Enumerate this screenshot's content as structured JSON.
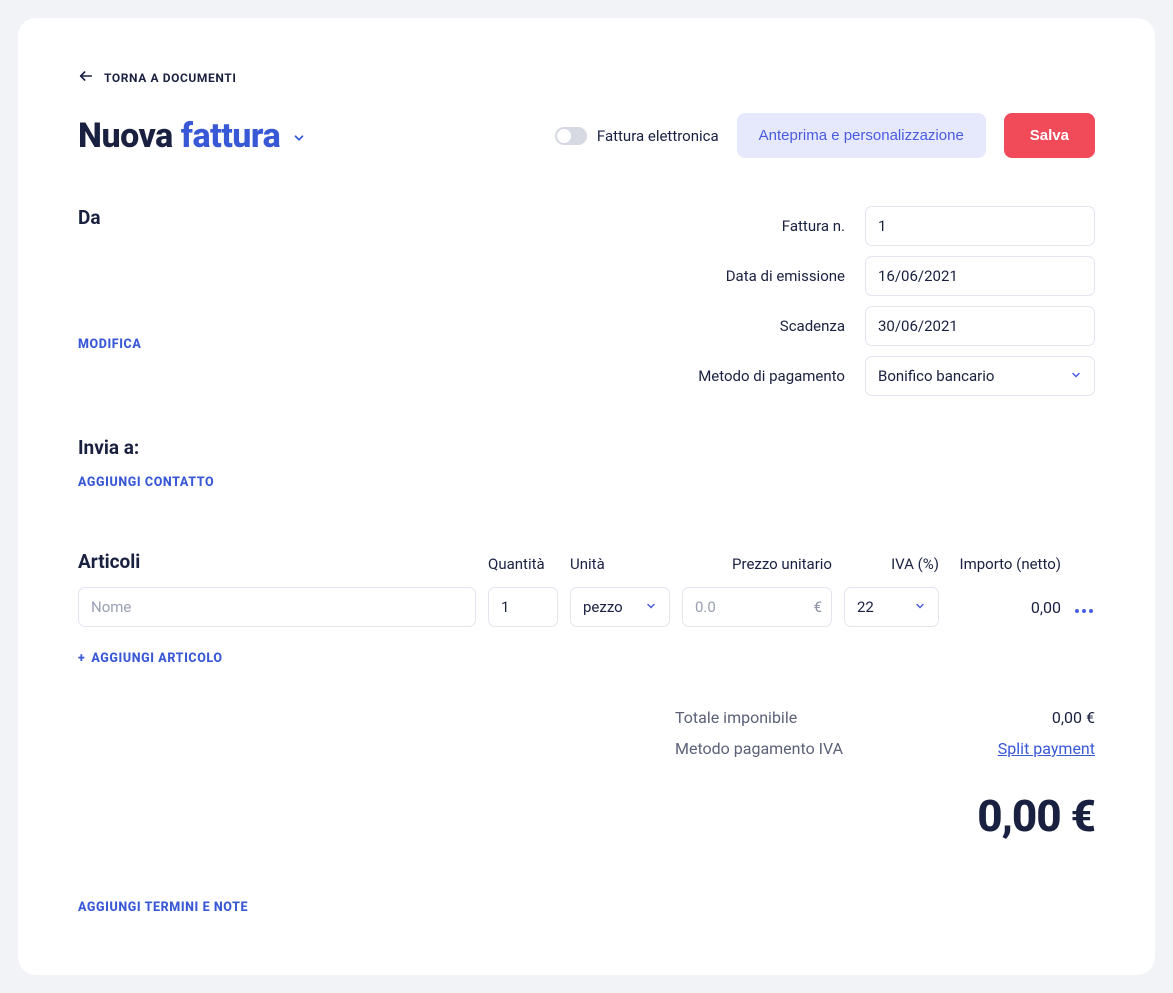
{
  "nav": {
    "back_label": "TORNA A DOCUMENTI"
  },
  "title": {
    "prefix": "Nuova",
    "main": "fattura"
  },
  "header": {
    "einvoice_label": "Fattura elettronica",
    "preview_label": "Anteprima e personalizzazione",
    "save_label": "Salva"
  },
  "from": {
    "label": "Da",
    "edit_label": "MODIFICA"
  },
  "fields": {
    "number_label": "Fattura n.",
    "number_value": "1",
    "issue_label": "Data di emissione",
    "issue_value": "16/06/2021",
    "due_label": "Scadenza",
    "due_value": "30/06/2021",
    "payment_label": "Metodo di pagamento",
    "payment_value": "Bonifico bancario"
  },
  "sendto": {
    "label": "Invia a:",
    "add_contact_label": "AGGIUNGI CONTATTO"
  },
  "articles": {
    "heading": "Articoli",
    "cols": {
      "qty": "Quantità",
      "unit": "Unità",
      "price": "Prezzo unitario",
      "vat": "IVA (%)",
      "amount": "Importo (netto)"
    },
    "row": {
      "name_placeholder": "Nome",
      "qty_value": "1",
      "unit_value": "pezzo",
      "price_placeholder": "0.0",
      "currency": "€",
      "vat_value": "22",
      "amount_value": "0,00"
    },
    "add_label": "AGGIUNGI ARTICOLO"
  },
  "totals": {
    "subtotal_label": "Totale imponibile",
    "subtotal_value": "0,00 €",
    "vat_method_label": "Metodo pagamento IVA",
    "split_label": "Split payment",
    "grand": "0,00 €"
  },
  "footer": {
    "terms_label": "AGGIUNGI TERMINI E NOTE"
  }
}
